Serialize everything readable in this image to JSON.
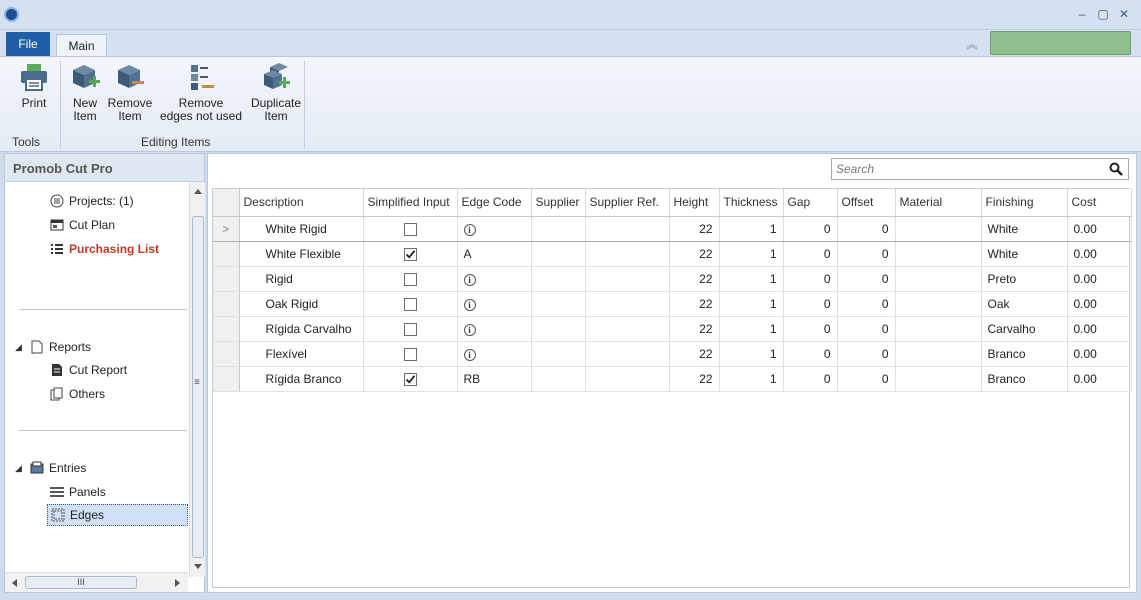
{
  "window": {
    "minimize_glyph": "‒",
    "maximize_glyph": "▢",
    "close_glyph": "✕",
    "collapse_glyph": "︽"
  },
  "ribbon": {
    "tabs": {
      "file": "File",
      "main": "Main"
    },
    "buttons": {
      "print": "Print",
      "new_item_line1": "New",
      "new_item_line2": "Item",
      "remove_item_line1": "Remove",
      "remove_item_line2": "Item",
      "remove_edges_line1": "Remove",
      "remove_edges_line2": "edges not used",
      "duplicate_line1": "Duplicate",
      "duplicate_line2": "Item"
    },
    "groups": {
      "tools": "Tools",
      "editing": "Editing Items"
    },
    "accent_color": "#1f5fa8",
    "green_box_color": "#8fbf8f"
  },
  "sidebar": {
    "title": "Promob Cut Pro",
    "projects": "Projects: (1)",
    "cut_plan": "Cut Plan",
    "purchasing_list": "Purchasing List",
    "reports": "Reports",
    "cut_report": "Cut Report",
    "others": "Others",
    "entries": "Entries",
    "panels": "Panels",
    "edges": "Edges",
    "expand_glyph": "◢",
    "scroll_grip": "≡",
    "hscroll_grip": "III",
    "highlight_color": "#c0392b"
  },
  "search": {
    "placeholder": "Search"
  },
  "table": {
    "row_marker": ">",
    "columns": [
      "Description",
      "Simplified Input",
      "Edge Code",
      "Supplier",
      "Supplier Ref.",
      "Height",
      "Thickness",
      "Gap",
      "Offset",
      "Material",
      "Finishing",
      "Cost"
    ],
    "rows": [
      {
        "description": "White Rigid",
        "simplified": false,
        "edge_code": "i",
        "supplier": "",
        "supplier_ref": "",
        "height": "22",
        "thickness": "1",
        "gap": "0",
        "offset": "0",
        "material": "",
        "finishing": "White",
        "cost": "0.00"
      },
      {
        "description": "White Flexible",
        "simplified": true,
        "edge_code": "A",
        "supplier": "",
        "supplier_ref": "",
        "height": "22",
        "thickness": "1",
        "gap": "0",
        "offset": "0",
        "material": "",
        "finishing": "White",
        "cost": "0.00"
      },
      {
        "description": "Rigid",
        "simplified": false,
        "edge_code": "i",
        "supplier": "",
        "supplier_ref": "",
        "height": "22",
        "thickness": "1",
        "gap": "0",
        "offset": "0",
        "material": "",
        "finishing": "Preto",
        "cost": "0.00"
      },
      {
        "description": "Oak Rigid",
        "simplified": false,
        "edge_code": "i",
        "supplier": "",
        "supplier_ref": "",
        "height": "22",
        "thickness": "1",
        "gap": "0",
        "offset": "0",
        "material": "",
        "finishing": "Oak",
        "cost": "0.00"
      },
      {
        "description": "Rígida Carvalho",
        "simplified": false,
        "edge_code": "i",
        "supplier": "",
        "supplier_ref": "",
        "height": "22",
        "thickness": "1",
        "gap": "0",
        "offset": "0",
        "material": "",
        "finishing": "Carvalho",
        "cost": "0.00"
      },
      {
        "description": "Flexível",
        "simplified": false,
        "edge_code": "i",
        "supplier": "",
        "supplier_ref": "",
        "height": "22",
        "thickness": "1",
        "gap": "0",
        "offset": "0",
        "material": "",
        "finishing": "Branco",
        "cost": "0.00"
      },
      {
        "description": "Rígida Branco",
        "simplified": true,
        "edge_code": "RB",
        "supplier": "",
        "supplier_ref": "",
        "height": "22",
        "thickness": "1",
        "gap": "0",
        "offset": "0",
        "material": "",
        "finishing": "Branco",
        "cost": "0.00"
      }
    ]
  }
}
